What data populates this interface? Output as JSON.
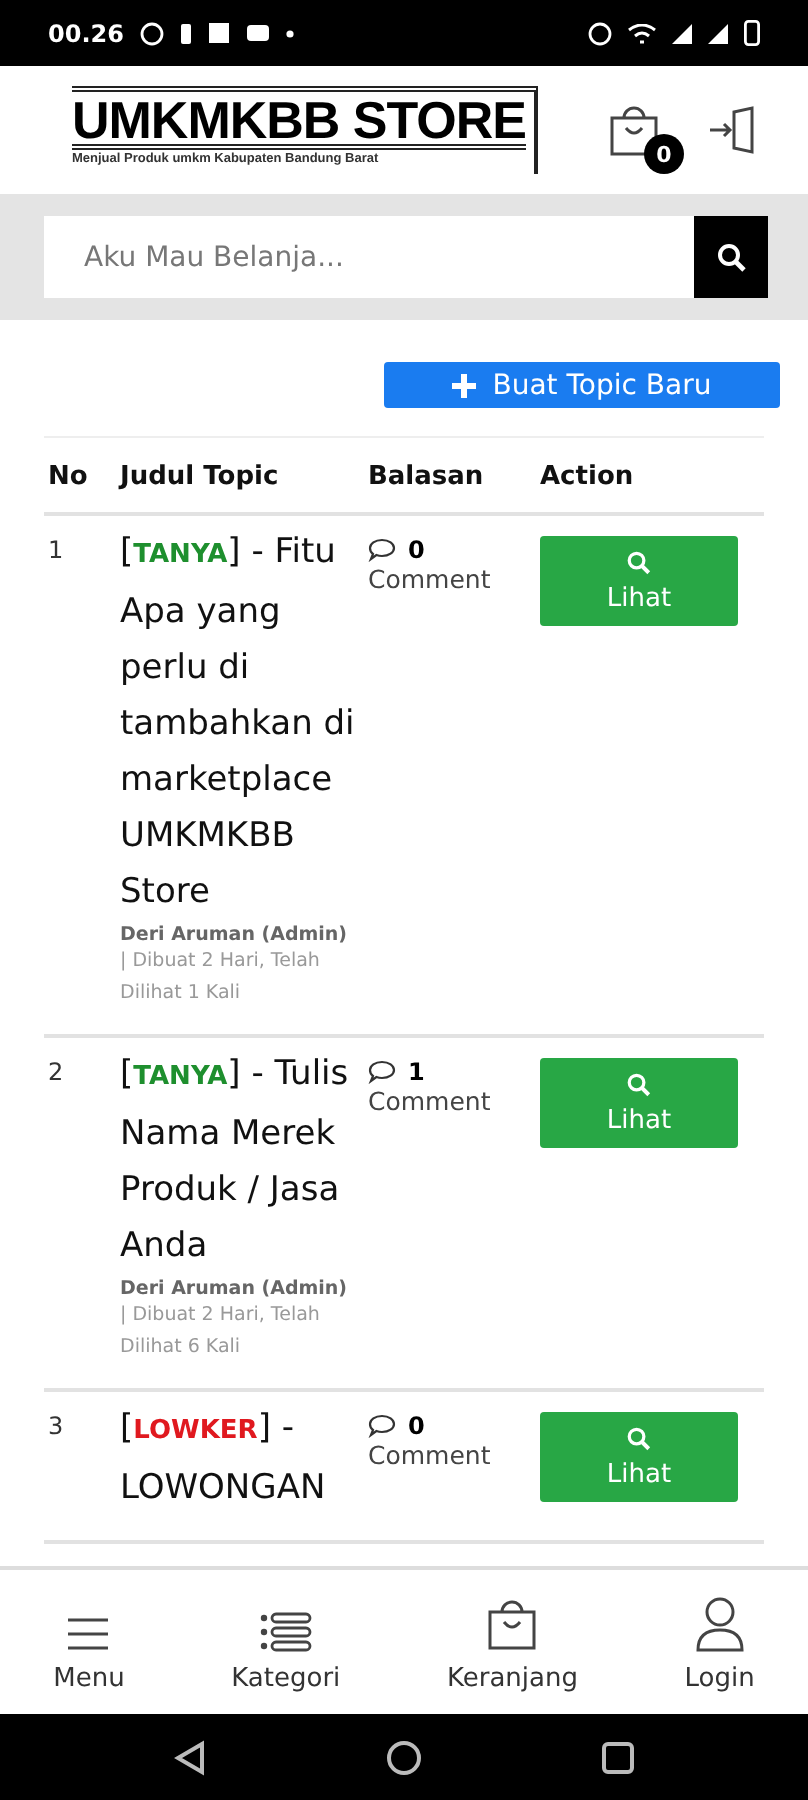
{
  "status_bar": {
    "time": "00.26"
  },
  "header": {
    "logo_title": "UMKMKBB STORE",
    "logo_subtitle": "Menjual Produk umkm Kabupaten Bandung Barat",
    "cart_count": "0"
  },
  "search": {
    "placeholder": "Aku Mau Belanja..."
  },
  "new_topic_button": "Buat Topic Baru",
  "table": {
    "columns": [
      "No",
      "Judul Topic",
      "Balasan",
      "Action"
    ],
    "rows": [
      {
        "no": "1",
        "color": "#1e8f2e",
        "title": "[**TANYA**] - Fitu Apa yang perlu di tambahkan di marketplace UMKMKBB Store",
        "author": "Deri Aruman (Admin)",
        "meta": "| Dibuat 2 Hari, Telah Dilihat 1 Kali",
        "replies": "0",
        "replies_label": "Comment",
        "action": "Lihat"
      },
      {
        "no": "2",
        "color": "#1e8f2e",
        "title": "[**TANYA**] - Tulis Nama Merek Produk / Jasa Anda",
        "author": "Deri Aruman (Admin)",
        "meta": "| Dibuat 2 Hari, Telah Dilihat 6 Kali",
        "replies": "1",
        "replies_label": "Comment",
        "action": "Lihat"
      },
      {
        "no": "3",
        "color": "#e0191f",
        "title": "[**LOWKER**] - LOWONGAN",
        "replies": "0",
        "replies_label": "Comment",
        "action": "Lihat"
      }
    ]
  },
  "bottom_nav": [
    {
      "kind": "menu",
      "label": "Menu"
    },
    {
      "kind": "category",
      "label": "Kategori"
    },
    {
      "kind": "cart",
      "label": "Keranjang"
    },
    {
      "kind": "user",
      "label": "Login"
    }
  ]
}
